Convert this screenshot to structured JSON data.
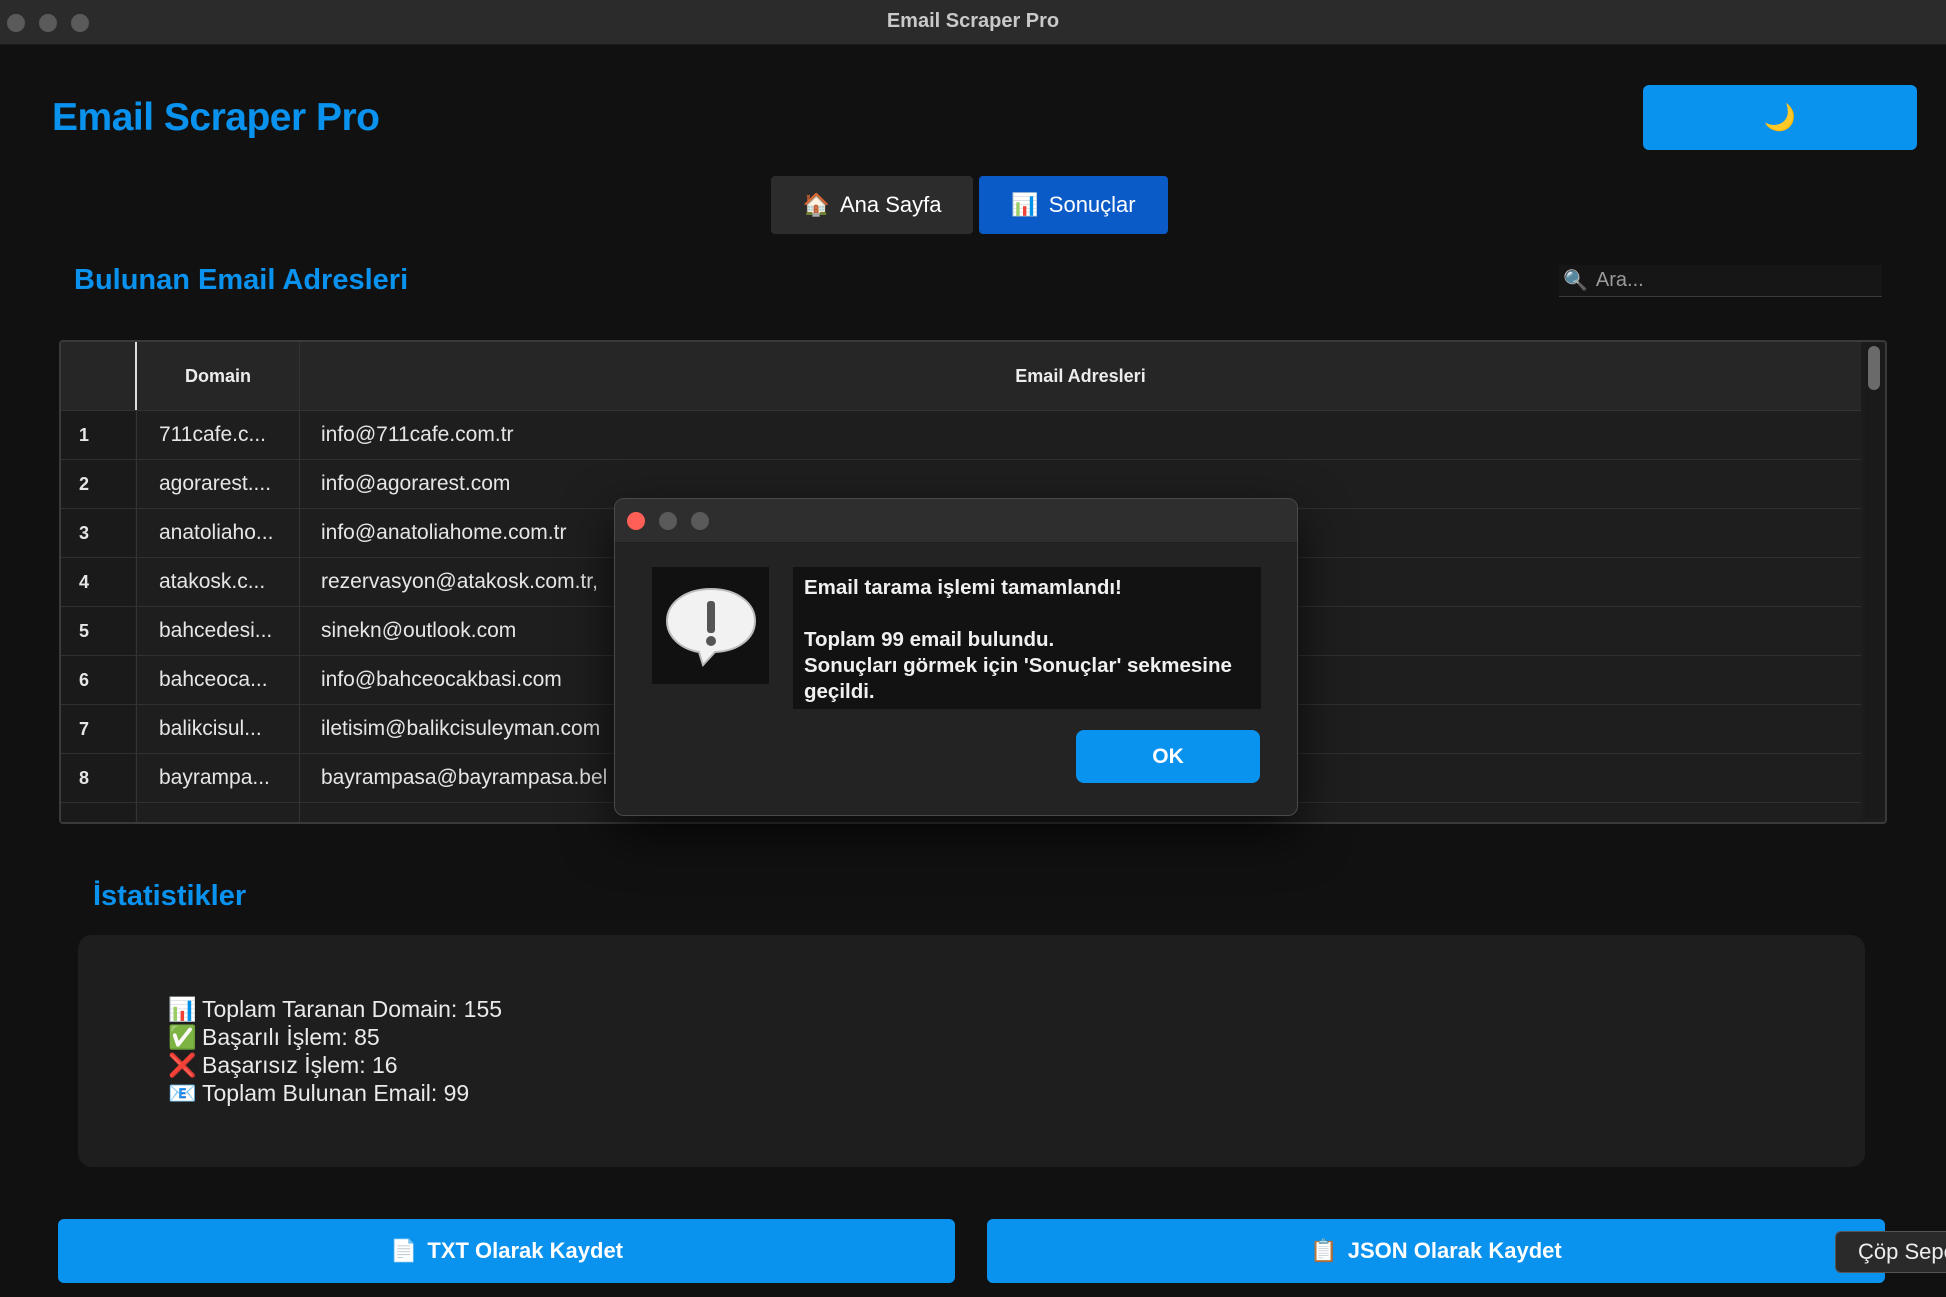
{
  "window": {
    "title": "Email Scraper Pro"
  },
  "header": {
    "app_title": "Email Scraper Pro",
    "theme_toggle_icon": "moon-icon",
    "theme_toggle_glyph": "🌙"
  },
  "tabs": [
    {
      "label": "Ana Sayfa",
      "icon": "home-icon",
      "glyph": "🏠",
      "active": false
    },
    {
      "label": "Sonuçlar",
      "icon": "chart-icon",
      "glyph": "📊",
      "active": true
    }
  ],
  "results": {
    "section_title": "Bulunan Email Adresleri",
    "search": {
      "placeholder": "Ara...",
      "value": "",
      "glyph": "🔍"
    },
    "columns": [
      "Domain",
      "Email Adresleri"
    ],
    "rows": [
      {
        "index": "1",
        "domain": "711cafe.c...",
        "email": "info@711cafe.com.tr"
      },
      {
        "index": "2",
        "domain": "agorarest....",
        "email": "info@agorarest.com"
      },
      {
        "index": "3",
        "domain": "anatoliaho...",
        "email": "info@anatoliahome.com.tr"
      },
      {
        "index": "4",
        "domain": "atakosk.c...",
        "email": "rezervasyon@atakosk.com.tr,"
      },
      {
        "index": "5",
        "domain": "bahcedesi...",
        "email": "sinekn@outlook.com"
      },
      {
        "index": "6",
        "domain": "bahceoca...",
        "email": "info@bahceocakbasi.com"
      },
      {
        "index": "7",
        "domain": "balikcisul...",
        "email": "iletisim@balikcisuleyman.com"
      },
      {
        "index": "8",
        "domain": "bayrampa...",
        "email": "bayrampasa@bayrampasa.bel"
      }
    ]
  },
  "stats": {
    "section_title": "İstatistikler",
    "items": [
      {
        "glyph": "📊",
        "icon": "chart-icon",
        "text": "Toplam Taranan Domain: 155"
      },
      {
        "glyph": "✅",
        "icon": "check-icon",
        "text": "Başarılı İşlem: 85"
      },
      {
        "glyph": "❌",
        "icon": "cross-icon",
        "text": "Başarısız İşlem: 16"
      },
      {
        "glyph": "📧",
        "icon": "email-icon",
        "text": "Toplam Bulunan Email: 99"
      }
    ]
  },
  "actions": {
    "txt_label": "TXT Olarak Kaydet",
    "txt_glyph": "📄",
    "json_label": "JSON Olarak Kaydet",
    "json_glyph": "📋",
    "trash_tooltip": "Çöp Sepeti"
  },
  "dialog": {
    "line1": "Email tarama işlemi tamamlandı!",
    "line2": "Toplam 99 email bulundu.",
    "line3": "Sonuçları görmek için 'Sonuçlar' sekmesine geçildi.",
    "ok_label": "OK",
    "icon": "warning-icon"
  }
}
